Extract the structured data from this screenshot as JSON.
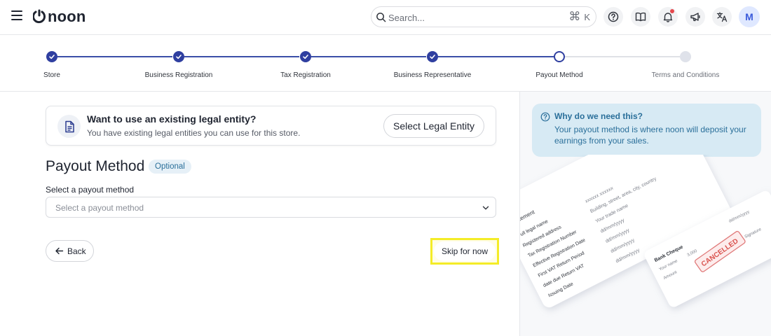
{
  "header": {
    "logo_text": "noon",
    "search_placeholder": "Search...",
    "shortcut_symbol": "⌘",
    "shortcut_key": "K",
    "avatar_initial": "M"
  },
  "stepper": {
    "steps": [
      {
        "label": "Store",
        "state": "done"
      },
      {
        "label": "Business Registration",
        "state": "done"
      },
      {
        "label": "Tax Registration",
        "state": "done"
      },
      {
        "label": "Business Representative",
        "state": "done"
      },
      {
        "label": "Payout Method",
        "state": "current"
      },
      {
        "label": "Terms and Conditions",
        "state": "todo"
      }
    ]
  },
  "legal_entity": {
    "title": "Want to use an existing legal entity?",
    "subtitle": "You have existing legal entities you can use for this store.",
    "button_label": "Select Legal Entity"
  },
  "payout": {
    "title": "Payout Method",
    "badge": "Optional",
    "field_label": "Select a payout method",
    "placeholder": "Select a payout method"
  },
  "actions": {
    "back_label": "Back",
    "skip_label": "Skip for now"
  },
  "info": {
    "title": "Why do we need this?",
    "text": "Your payout method is where noon will deposit your earnings from your sales."
  },
  "illustration": {
    "doc_heading": "Statement",
    "doc_rows": [
      "Full legal name",
      "Registered address",
      "Tax Registration Number",
      "Effective Registration Date",
      "First VAT Return Period",
      "date due Return VAT",
      "Issuing Date"
    ],
    "doc_values": [
      "xxxxxx xxxxxx",
      "Building, street, area, city, country",
      "Your trade name",
      "dd/mm/yyyy",
      "dd/mm/yyyy",
      "dd/mm/yyyy",
      "dd/mm/yyyy"
    ],
    "cheque_title": "Bank Cheque",
    "cheque_name": "Your name",
    "cheque_amount_label": "Amount",
    "cheque_amount": "3,000",
    "cheque_date": "dd/mm/yyyy",
    "cheque_signature": "Signature",
    "stamp": "CANCELLED"
  },
  "colors": {
    "primary": "#2f3fa0",
    "highlight": "#f4ec27",
    "info_bg": "#d7eaf4",
    "info_text": "#2a6f9a",
    "notification": "#e5484d"
  }
}
